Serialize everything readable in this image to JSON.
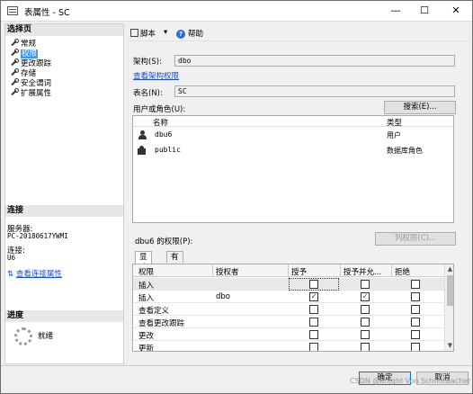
{
  "window": {
    "title": "表属性 - SC",
    "min_glyph": "—",
    "max_glyph": "☐",
    "close_glyph": "✕"
  },
  "left": {
    "select_page_header": "选择页",
    "nav": [
      {
        "label": "常规",
        "selected": false
      },
      {
        "label": "权限",
        "selected": true
      },
      {
        "label": "更改跟踪",
        "selected": false
      },
      {
        "label": "存储",
        "selected": false
      },
      {
        "label": "安全谓词",
        "selected": false
      },
      {
        "label": "扩展属性",
        "selected": false
      }
    ],
    "connection_header": "连接",
    "server_label": "服务器:",
    "server_value": "PC-20180617YWMI",
    "connection_label": "连接:",
    "connection_value": "U6",
    "view_conn_props": "查看连接属性",
    "progress_header": "进度",
    "progress_status": "就绪"
  },
  "toolbar": {
    "script_label": "脚本",
    "dropdown_glyph": "▾",
    "help_label": "帮助"
  },
  "form": {
    "schema_label": "架构(S):",
    "schema_value": "dbo",
    "view_schema_perms": "查看架构权限",
    "table_name_label": "表名(N):",
    "table_name_value": "SC",
    "users_roles_label": "用户或角色(U):",
    "search_button": "搜索(E)..."
  },
  "principals": {
    "headers": {
      "name": "名称",
      "type": "类型"
    },
    "rows": [
      {
        "name": "dbu6",
        "type": "用户",
        "icon": "user-icon"
      },
      {
        "name": "public",
        "type": "数据库角色",
        "icon": "role-icon"
      }
    ]
  },
  "permissions": {
    "title": "dbu6 的权限(P):",
    "column_perms_button": "列权限(C)...",
    "tabs": [
      "显式",
      "有效"
    ],
    "headers": {
      "perm": "权限",
      "grantor": "授权者",
      "grant": "授予",
      "with_grant": "授予并允...",
      "deny": "拒绝"
    },
    "rows": [
      {
        "perm": "插入",
        "grantor": "",
        "grant": false,
        "with_grant": false,
        "deny": false,
        "selected": true
      },
      {
        "perm": "插入",
        "grantor": "dbo",
        "grant": true,
        "with_grant": true,
        "deny": false,
        "selected": false
      },
      {
        "perm": "查看定义",
        "grantor": "",
        "grant": false,
        "with_grant": false,
        "deny": false,
        "selected": false
      },
      {
        "perm": "查看更改跟踪",
        "grantor": "",
        "grant": false,
        "with_grant": false,
        "deny": false,
        "selected": false
      },
      {
        "perm": "更改",
        "grantor": "",
        "grant": false,
        "with_grant": false,
        "deny": false,
        "selected": false
      },
      {
        "perm": "更新",
        "grantor": "",
        "grant": false,
        "with_grant": false,
        "deny": false,
        "selected": false
      }
    ]
  },
  "buttons": {
    "ok": "确定",
    "cancel": "取消"
  },
  "watermark": "CSDN @Knight Von Schmitbacher"
}
